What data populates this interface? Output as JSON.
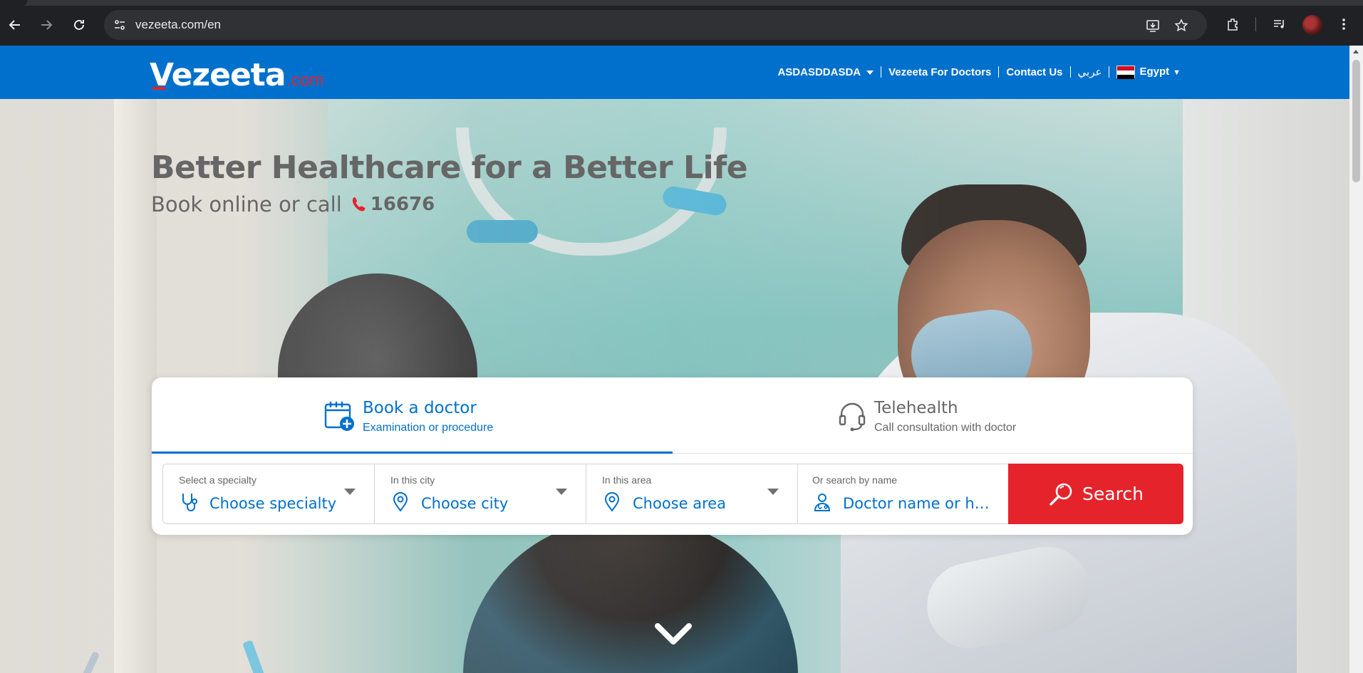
{
  "browser": {
    "url": "vezeeta.com/en",
    "back_icon": "arrow-left-icon",
    "forward_icon": "arrow-right-icon",
    "reload_icon": "reload-icon"
  },
  "header": {
    "logo_main": "Vezeeta",
    "logo_suffix": ".com",
    "nav": {
      "account": "ASDASDDASDA",
      "for_doctors": "Vezeeta For Doctors",
      "contact": "Contact Us",
      "language": "عربي",
      "country": "Egypt"
    },
    "colors": {
      "brand_blue": "#0070cd",
      "accent_red": "#e5232b"
    }
  },
  "hero": {
    "title": "Better Healthcare for a Better Life",
    "subtitle": "Book online or call",
    "phone": "16676"
  },
  "search": {
    "tabs": [
      {
        "title": "Book a doctor",
        "subtitle": "Examination or procedure",
        "active": true,
        "icon": "calendar-plus-icon"
      },
      {
        "title": "Telehealth",
        "subtitle": "Call consultation with doctor",
        "active": false,
        "icon": "headset-icon"
      }
    ],
    "fields": [
      {
        "label": "Select a specialty",
        "value": "Choose specialty",
        "icon": "stethoscope-icon"
      },
      {
        "label": "In this city",
        "value": "Choose city",
        "icon": "location-pin-icon"
      },
      {
        "label": "In this area",
        "value": "Choose area",
        "icon": "location-pin-icon"
      },
      {
        "label": "Or search by name",
        "placeholder": "Doctor name or hospital name",
        "icon": "doctor-icon"
      }
    ],
    "button_label": "Search"
  }
}
